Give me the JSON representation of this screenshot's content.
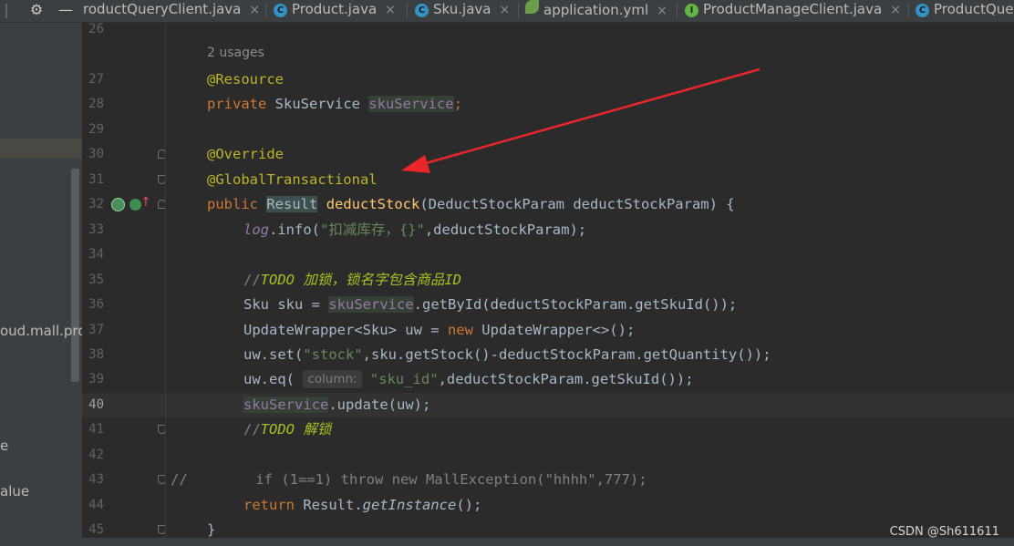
{
  "tabbar": {
    "tabs": [
      {
        "label": "roductQueryClient.java",
        "icon": "none"
      },
      {
        "label": "Product.java",
        "icon": "class-c-icon"
      },
      {
        "label": "Sku.java",
        "icon": "class-c-icon"
      },
      {
        "label": "application.yml",
        "icon": "spring-leaf-icon"
      },
      {
        "label": "ProductManageClient.java",
        "icon": "interface-i-icon"
      },
      {
        "label": "ProductQue",
        "icon": "class-c-icon"
      }
    ],
    "close_glyph": "×",
    "icon_letter_c": "C",
    "icon_letter_i": "I"
  },
  "left_panel": {
    "items": [
      "oud.mall.pro",
      "e",
      "alue"
    ]
  },
  "editor": {
    "usages_hint": "2 usages",
    "param_hint": "column:",
    "current_line": "40",
    "lines": {
      "26": "26",
      "27": "27",
      "28": "28",
      "29": "29",
      "30": "30",
      "31": "31",
      "32": "32",
      "33": "33",
      "34": "34",
      "35": "35",
      "36": "36",
      "37": "37",
      "38": "38",
      "39": "39",
      "40": "40",
      "41": "41",
      "42": "42",
      "43": "43",
      "44": "44",
      "45": "45"
    },
    "code": {
      "l27_ann": "@Resource",
      "l28_kw": "private",
      "l28_type": " SkuService ",
      "l28_field": "skuService",
      "l28_end": ";",
      "l30_ann": "@Override",
      "l31_ann": "@GlobalTransactional",
      "l32_kw": "public",
      "l32_sp": " ",
      "l32_type": "Result",
      "l32_sp2": " ",
      "l32_method": "deductStock",
      "l32_rest": "(DeductStockParam deductStockParam) {",
      "l33_log": "log",
      "l33_mid": ".info(",
      "l33_str": "\"扣减库存，{}\"",
      "l33_end": ",deductStockParam);",
      "l35_slashes": "//",
      "l35_todo": "TODO 加锁，锁名字包含商品ID",
      "l36_a": "Sku sku = ",
      "l36_field": "skuService",
      "l36_b": ".getById(deductStockParam.getSkuId());",
      "l37_a": "UpdateWrapper<Sku> uw = ",
      "l37_kw": "new",
      "l37_b": " UpdateWrapper<>();",
      "l38_a": "uw.set(",
      "l38_str": "\"stock\"",
      "l38_b": ",sku.getStock()-deductStockParam.getQuantity());",
      "l39_a": "uw.eq( ",
      "l39_str": "\"sku_id\"",
      "l39_b": ",deductStockParam.getSkuId());",
      "l40_field": "skuService",
      "l40_b": ".update(uw);",
      "l41_slashes": "//",
      "l41_todo": "TODO 解锁",
      "l43_comment": "//        if (1==1) throw new MallException(\"hhhh\",777);",
      "l44_kw": "return",
      "l44_a": " Result.",
      "l44_static": "getInstance",
      "l44_b": "();",
      "l45_brace": "}"
    }
  },
  "watermark": "CSDN @Sh611611",
  "colors": {
    "background": "#2b2b2b",
    "keyword": "#cc7832",
    "annotation": "#bbb529",
    "method": "#ffc66d",
    "string": "#6a8759",
    "todo": "#a8c023",
    "field": "#9876aa",
    "arrow": "#e8262b"
  }
}
